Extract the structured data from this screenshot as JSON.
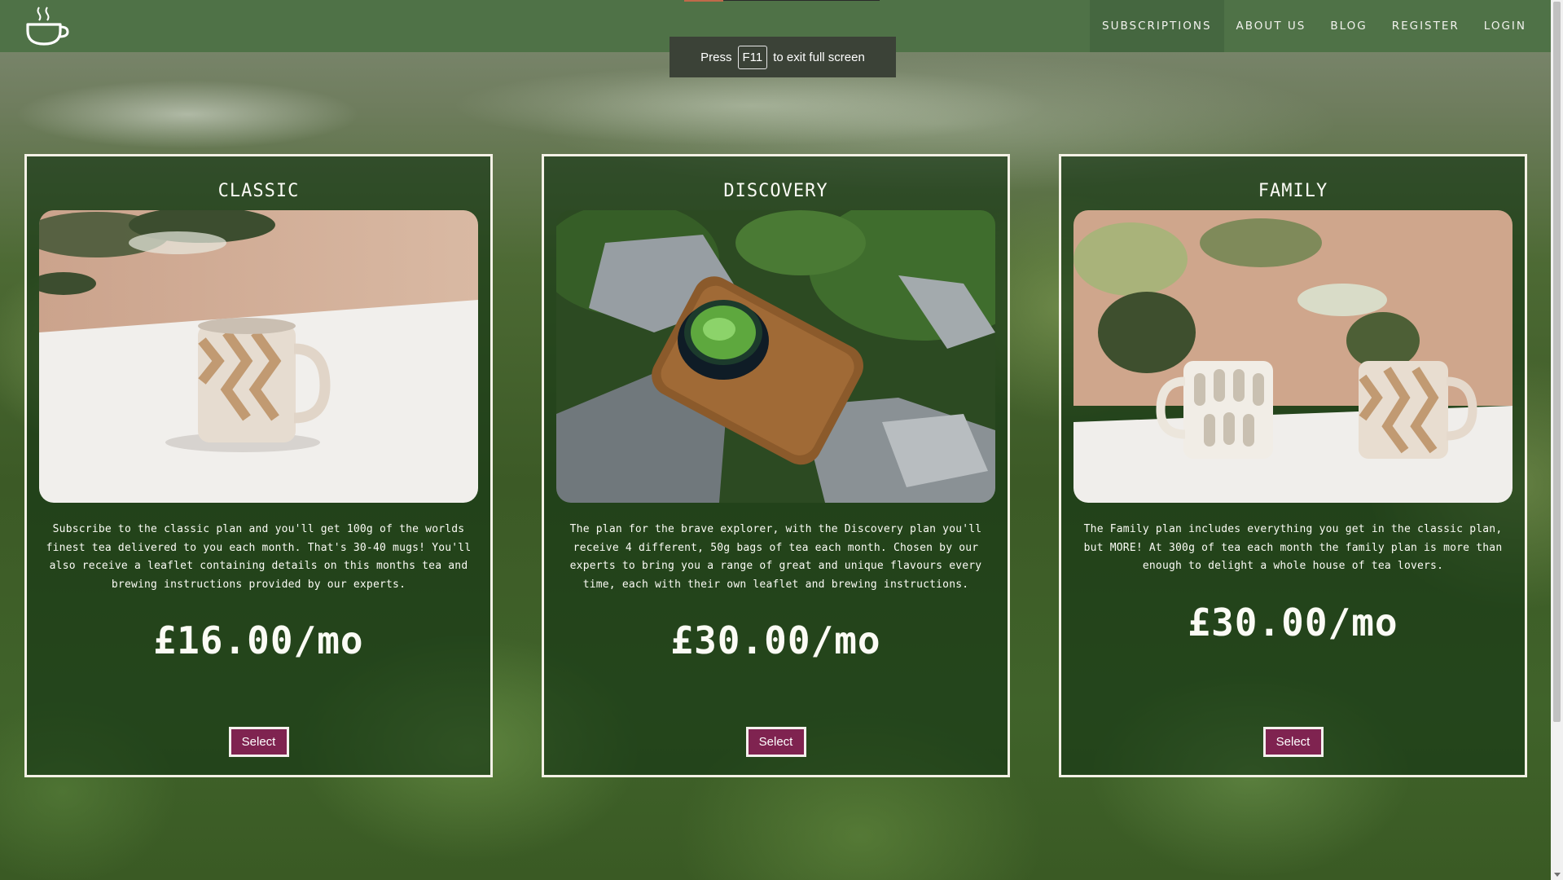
{
  "nav": {
    "items": [
      {
        "label": "SUBSCRIPTIONS",
        "active": true
      },
      {
        "label": "ABOUT US"
      },
      {
        "label": "BLOG"
      },
      {
        "label": "REGISTER"
      },
      {
        "label": "LOGIN"
      }
    ]
  },
  "fullscreen_toast": {
    "press": "Press",
    "key": "F11",
    "message": "to exit full screen"
  },
  "plans": [
    {
      "title": "CLASSIC",
      "description": "Subscribe to the classic plan and you'll get 100g of the worlds finest tea delivered to you each month. That's 30-40 mugs! You'll also receive a leaflet containing details on this months tea and brewing instructions provided by our experts.",
      "price": "£16.00/mo",
      "button": "Select"
    },
    {
      "title": "DISCOVERY",
      "description": "The plan for the brave explorer, with the Discovery plan you'll receive 4 different, 50g bags of tea each month. Chosen by our experts to bring you a range of great and unique flavours every time, each with their own leaflet and brewing instructions.",
      "price": "£30.00/mo",
      "button": "Select"
    },
    {
      "title": "FAMILY",
      "description": "The Family plan includes everything you get in the classic plan, but MORE! At 300g of tea each month the family plan is more than enough to delight a whole house of tea lovers.",
      "price": "£30.00/mo",
      "button": "Select"
    }
  ],
  "colors": {
    "navbar": "#4f7247",
    "select_button": "#7f2350",
    "card_border": "#f4f1e6"
  }
}
